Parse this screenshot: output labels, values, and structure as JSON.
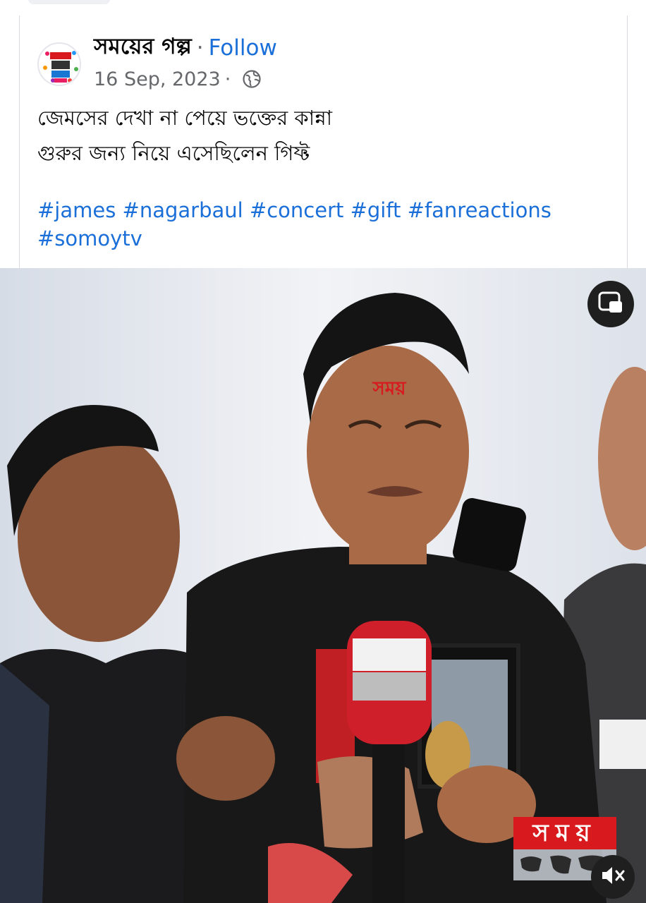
{
  "post": {
    "page_name": "সময়ের গল্প",
    "separator": "·",
    "follow_label": "Follow",
    "date": "16 Sep, 2023",
    "meta_separator": "·",
    "audience_icon": "globe-icon",
    "text_lines": [
      "জেমসের দেখা না পেয়ে ভক্তের কান্না",
      "গুরুর জন্য নিয়ে এসেছিলেন গিফ্ট"
    ],
    "hashtags_line1": "#james #nagarbaul #concert #gift #fanreactions",
    "hashtags_line2": "#somoytv"
  },
  "video": {
    "channel_logo_text": "সময়",
    "mic_label": "সময়",
    "pip_icon": "picture-in-picture-icon",
    "mute_icon": "volume-muted-icon"
  },
  "colors": {
    "link": "#1b6fd8",
    "text": "#050505",
    "muted": "#65676b",
    "brand_red": "#d8191d"
  }
}
